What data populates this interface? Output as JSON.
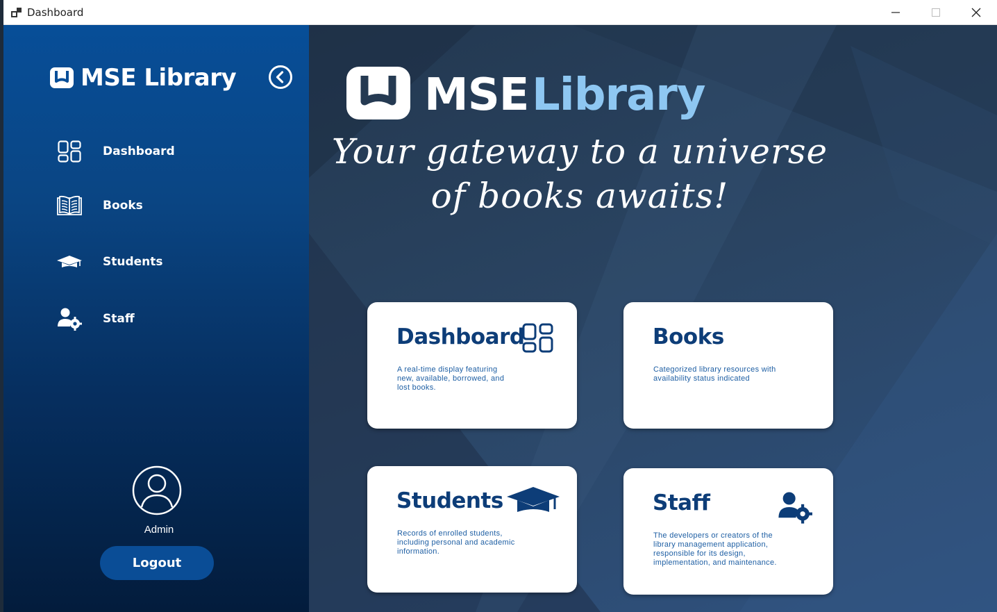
{
  "window": {
    "title": "Dashboard"
  },
  "sidebar": {
    "brand": "MSE Library",
    "items": [
      {
        "label": "Dashboard",
        "icon": "dashboard-grid-icon"
      },
      {
        "label": "Books",
        "icon": "open-book-icon"
      },
      {
        "label": "Students",
        "icon": "graduation-cap-icon"
      },
      {
        "label": "Staff",
        "icon": "user-gear-icon"
      }
    ],
    "user": {
      "name": "Admin",
      "icon": "user-circle-icon"
    },
    "logout_label": "Logout"
  },
  "hero": {
    "brand_mse": "MSE",
    "brand_library": "Library",
    "tagline": "Your gateway to a universe of books awaits!"
  },
  "cards": [
    {
      "title": "Dashboard",
      "description": "A real-time display featuring new, available, borrowed, and lost books.",
      "icon": "dashboard-grid-icon"
    },
    {
      "title": "Books",
      "description": "Categorized library resources with availability status indicated",
      "icon": ""
    },
    {
      "title": "Students",
      "description": "Records of enrolled students, including personal and academic information.",
      "icon": "graduation-cap-icon"
    },
    {
      "title": "Staff",
      "description": "The developers or creators of the library management application, responsible for its design, implementation, and maintenance.",
      "icon": "user-gear-icon"
    }
  ],
  "colors": {
    "accent": "#8ec7f2",
    "card_title": "#0d3d78",
    "sidebar_top": "#074e98",
    "sidebar_bottom": "#031c3c"
  }
}
